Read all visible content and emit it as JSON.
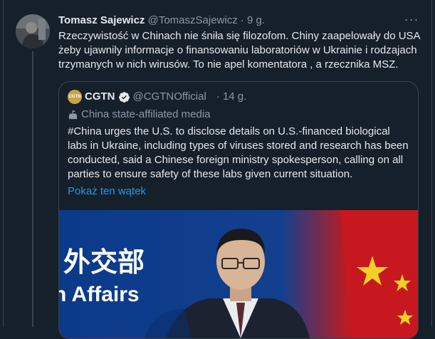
{
  "tweet": {
    "author_name": "Tomasz Sajewicz",
    "author_handle": "@TomaszSajewicz",
    "separator": "·",
    "time": "9 g.",
    "more_label": "···",
    "text": "Rzeczywistość w Chinach nie śniła się filozofom. Chiny zaapelowały do USA żeby ujawnily informacje o finansowaniu laboratoriów w Ukrainie i rodzajach trzymanych w nich wirusów. To nie apel komentatora , a rzecznika MSZ."
  },
  "quote": {
    "avatar_text": "CGTN",
    "author_name": "CGTN",
    "author_handle": "@CGTNOfficial",
    "time": "· 14 g.",
    "label": "China state-affiliated media",
    "text": "#China urges the U.S. to disclose details on U.S.-financed biological labs in Ukraine, including types of viruses stored and research has been conducted, said a Chinese foreign ministry spokesperson, calling on all parties to ensure safety of these labs given current situation.",
    "thread_link": "Pokaż ten wątek",
    "media": {
      "sign_chinese": "外交部",
      "sign_english": "n Affairs"
    }
  },
  "colors": {
    "background": "#15202b",
    "text": "#e7e9ea",
    "secondary": "#8b98a5",
    "link": "#1d9bf0",
    "border": "#38444d"
  },
  "icons": {
    "more": "ellipsis-icon",
    "verified": "verified-badge-icon",
    "label": "state-media-flag-icon"
  }
}
